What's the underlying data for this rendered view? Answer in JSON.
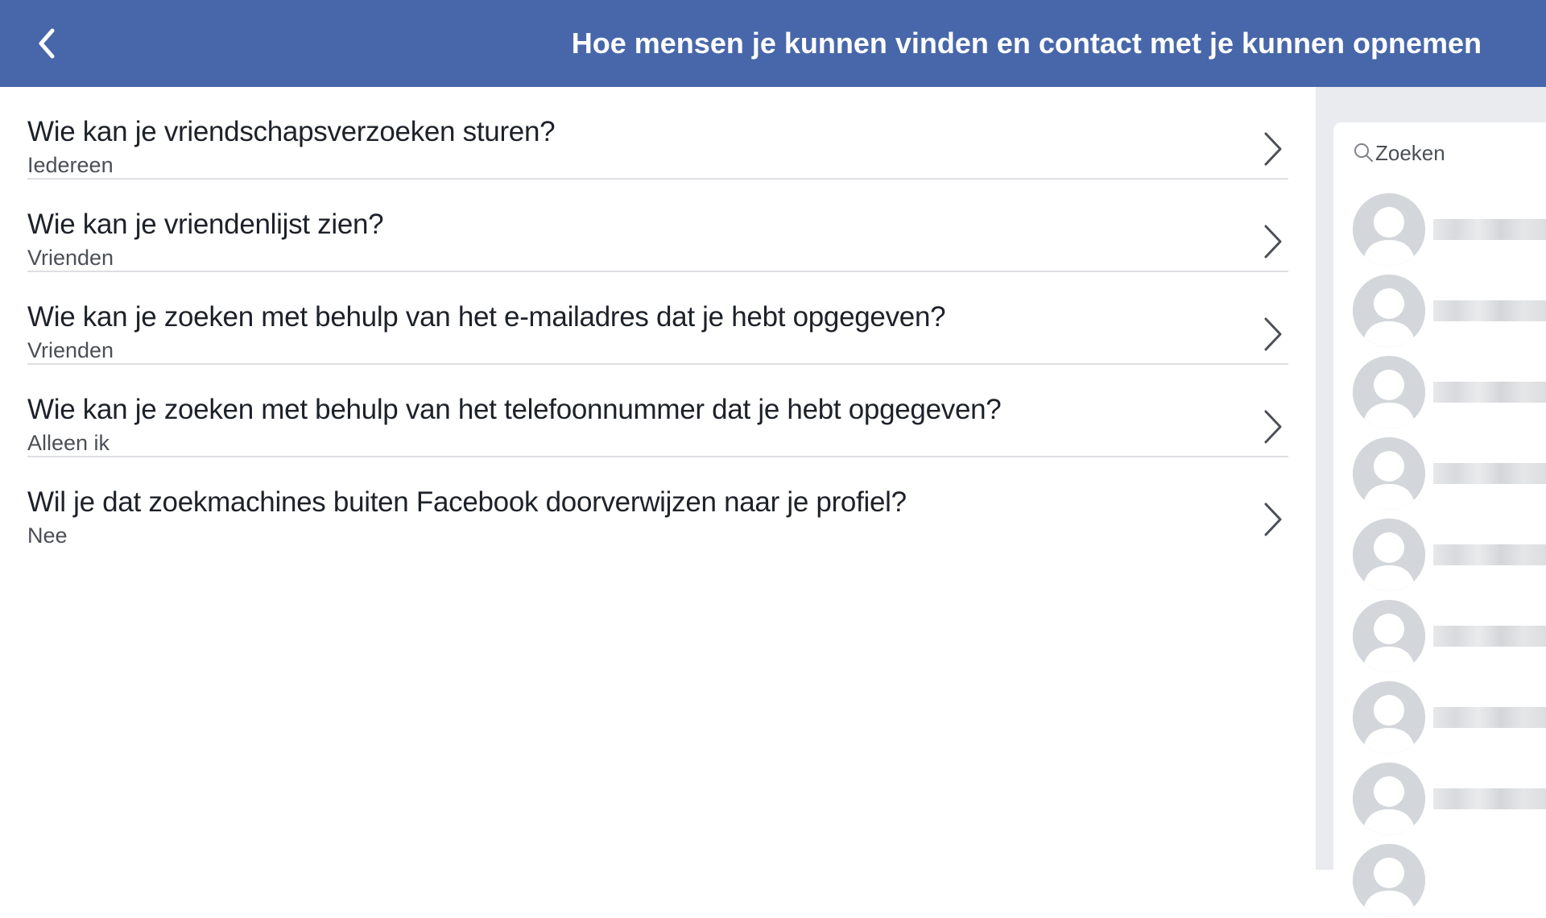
{
  "header": {
    "title": "Hoe mensen je kunnen vinden en contact met je kunnen opnemen",
    "back_icon": "chevron-left-icon",
    "background_color": "#4867aa"
  },
  "settings": [
    {
      "question": "Wie kan je vriendschapsverzoeken sturen?",
      "value": "Iedereen"
    },
    {
      "question": "Wie kan je vriendenlijst zien?",
      "value": "Vrienden"
    },
    {
      "question": "Wie kan je zoeken met behulp van het e-mailadres dat je hebt opgegeven?",
      "value": "Vrienden"
    },
    {
      "question": "Wie kan je zoeken met behulp van het telefoonnummer dat je hebt opgegeven?",
      "value": "Alleen ik"
    },
    {
      "question": "Wil je dat zoekmachines buiten Facebook doorverwijzen naar je profiel?",
      "value": "Nee"
    }
  ],
  "sidebar": {
    "search_placeholder": "Zoeken",
    "search_icon": "search-icon",
    "contacts_count_visible": 9
  }
}
